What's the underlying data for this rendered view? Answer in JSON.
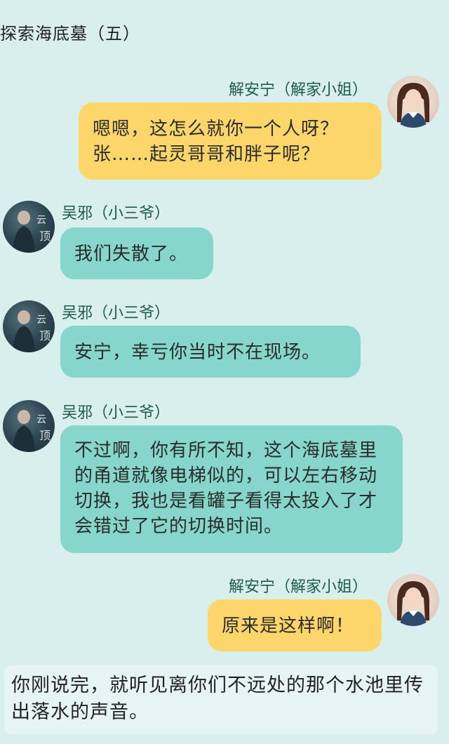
{
  "title": "探索海底墓（五）",
  "messages": [
    {
      "speaker": "解安宁（解家小姐）",
      "side": "right",
      "text": "嗯嗯，这怎么就你一个人呀？张……起灵哥哥和胖子呢？"
    },
    {
      "speaker": "吴邪（小三爷）",
      "side": "left",
      "text": "我们失散了。"
    },
    {
      "speaker": "吴邪（小三爷）",
      "side": "left",
      "text": "安宁，幸亏你当时不在现场。"
    },
    {
      "speaker": "吴邪（小三爷）",
      "side": "left",
      "text": "不过啊，你有所不知，这个海底墓里的甬道就像电梯似的，可以左右移动切换，我也是看罐子看得太投入了才会错过了它的切换时间。"
    },
    {
      "speaker": "解安宁（解家小姐）",
      "side": "right",
      "text": "原来是这样啊！"
    }
  ],
  "narration": "你刚说完，就听见离你们不远处的那个水池里传出落水的声音。",
  "colors": {
    "background": "#d9efee",
    "left_bubble": "#86d6cb",
    "right_bubble": "#fdd66b",
    "speaker_name": "#1f5a4a",
    "narration_bg": "#e6f5f4"
  },
  "icons": {
    "wu_xie": "avatar-wu-xie",
    "xie_anning": "avatar-xie-anning"
  }
}
